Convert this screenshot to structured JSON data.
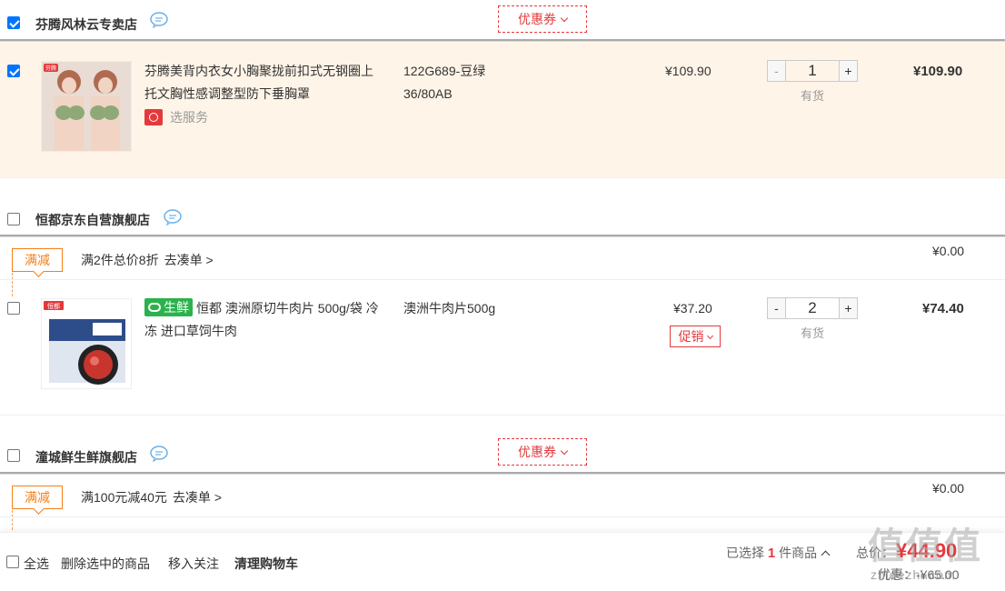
{
  "shops": [
    {
      "name": "芬腾风林云专卖店",
      "coupon_label": "优惠券",
      "items": [
        {
          "title": "芬腾美背内衣女小胸聚拢前扣式无钢圈上托文胸性感调整型防下垂胸罩",
          "service": "选服务",
          "spec_lines": [
            "122G689-豆绿",
            "36/80AB"
          ],
          "price": "¥109.90",
          "qty": "1",
          "stock": "有货",
          "sum": "¥109.90",
          "thumb_logo": "芬腾"
        }
      ]
    },
    {
      "name": "恒都京东自营旗舰店",
      "promo": {
        "tag": "满减",
        "text": "满2件总价8折",
        "link": "去凑单 >",
        "price": "¥0.00"
      },
      "items": [
        {
          "badge": "生鲜",
          "title": "恒都 澳洲原切牛肉片 500g/袋 冷冻 进口草饲牛肉",
          "spec_lines": [
            "澳洲牛肉片500g"
          ],
          "price": "¥37.20",
          "promo_select": "促销",
          "qty": "2",
          "stock": "有货",
          "sum": "¥74.40",
          "thumb_logo": "恒都"
        }
      ]
    },
    {
      "name": "潼城鲜生鲜旗舰店",
      "coupon_label": "优惠券",
      "promo": {
        "tag": "满减",
        "text": "满100元减40元",
        "link": "去凑单 >",
        "price": "¥0.00"
      }
    }
  ],
  "footer": {
    "select_all": "全选",
    "delete_selected": "删除选中的商品",
    "move_to_favorites": "移入关注",
    "clear_cart": "清理购物车",
    "selected_prefix": "已选择",
    "selected_count": "1",
    "selected_suffix": "件商品",
    "total_label": "总价：",
    "total_price": "¥44.90",
    "discount_label": "优惠：",
    "discount_value": "-¥65.00"
  },
  "watermark": {
    "text": "值值值",
    "url": "zhidezhi.com"
  },
  "colors": {
    "accent_red": "#e4393c",
    "selected_row_bg": "#fff4e8",
    "promo_orange": "#f57f17",
    "fresh_green": "#2bb24c",
    "checkbox_blue": "#0075ff"
  }
}
